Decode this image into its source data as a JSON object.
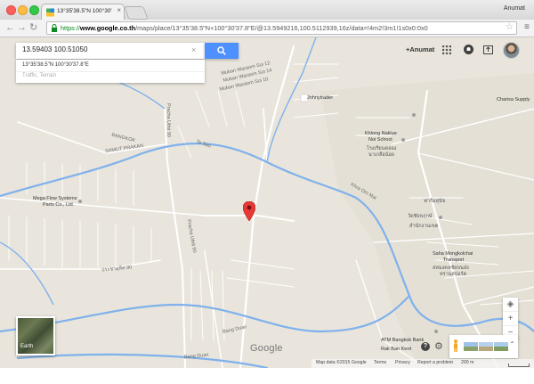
{
  "browser": {
    "tab_title": "13°35'38.5\"N 100°30'37.8\"E",
    "user_name": "Anumat",
    "url_scheme": "https://",
    "url_domain": "www.google.co.th",
    "url_path": "/maps/place/13°35'38.5\"N+100°30'37.8\"E/@13.5949216,100.5112939,16z/data=!4m2!3m1!1s0x0:0x0"
  },
  "maps": {
    "search": {
      "value": "13.59403 100.51050"
    },
    "suggestion": {
      "coordinates": "13°35'38.5\"N 100°30'37.8\"E",
      "layers_hint": "Traffic, Terrain"
    },
    "account": {
      "label": "+Anumat"
    },
    "earth_label": "Earth",
    "google_logo": "Google",
    "zoom": {
      "locate": "◈",
      "in": "+",
      "out": "−"
    },
    "footer": {
      "map_data": "Map data ©2015 Google",
      "terms": "Terms",
      "privacy": "Privacy",
      "report": "Report a problem",
      "scale": "200 m"
    },
    "labels": {
      "soi12": "Muban Waraom Soi 12",
      "soi14": "Muban Waraom Soi 14",
      "soi10": "Muban Waraom Soi 10",
      "johnny": "Johnytrader",
      "charisa": "Charisa Supply",
      "khlong": "Khlong Naklue",
      "khlong2": "Noi School",
      "khlong_th": "โรงเรียนคลอง",
      "khlong_th2": "นาเกลือน้อย",
      "bangkok": "BANGKOK",
      "samut": "SAMUT PRAKAN",
      "tesan": "Te San",
      "kheamai": "Khra Om Mai",
      "megaflow": "Mega Flow Systems",
      "megaflow2": "Parts Co., Ltd.",
      "pracha": "Pracha Uthit 90",
      "pracha2": "Pracha Uthit 90",
      "thai_road": "ประชาอุทิศ 90",
      "saha": "Saha Mongkolchai",
      "saha2": "Transport",
      "saha_th": "สหมงคลชัยขนส่ง",
      "saha_th2": "ทรานสปอร์ต",
      "atm": "ATM Bangkok Bank",
      "raiban": "Rak Ban Kerd",
      "bangdum": "Bang Duan",
      "bangdum2": "Bang Duan",
      "thai1": "ฟาร์มสุนัข",
      "thai2": "วัดชัยพฤกษ์",
      "thai3": "สำนักงานเขต"
    }
  }
}
